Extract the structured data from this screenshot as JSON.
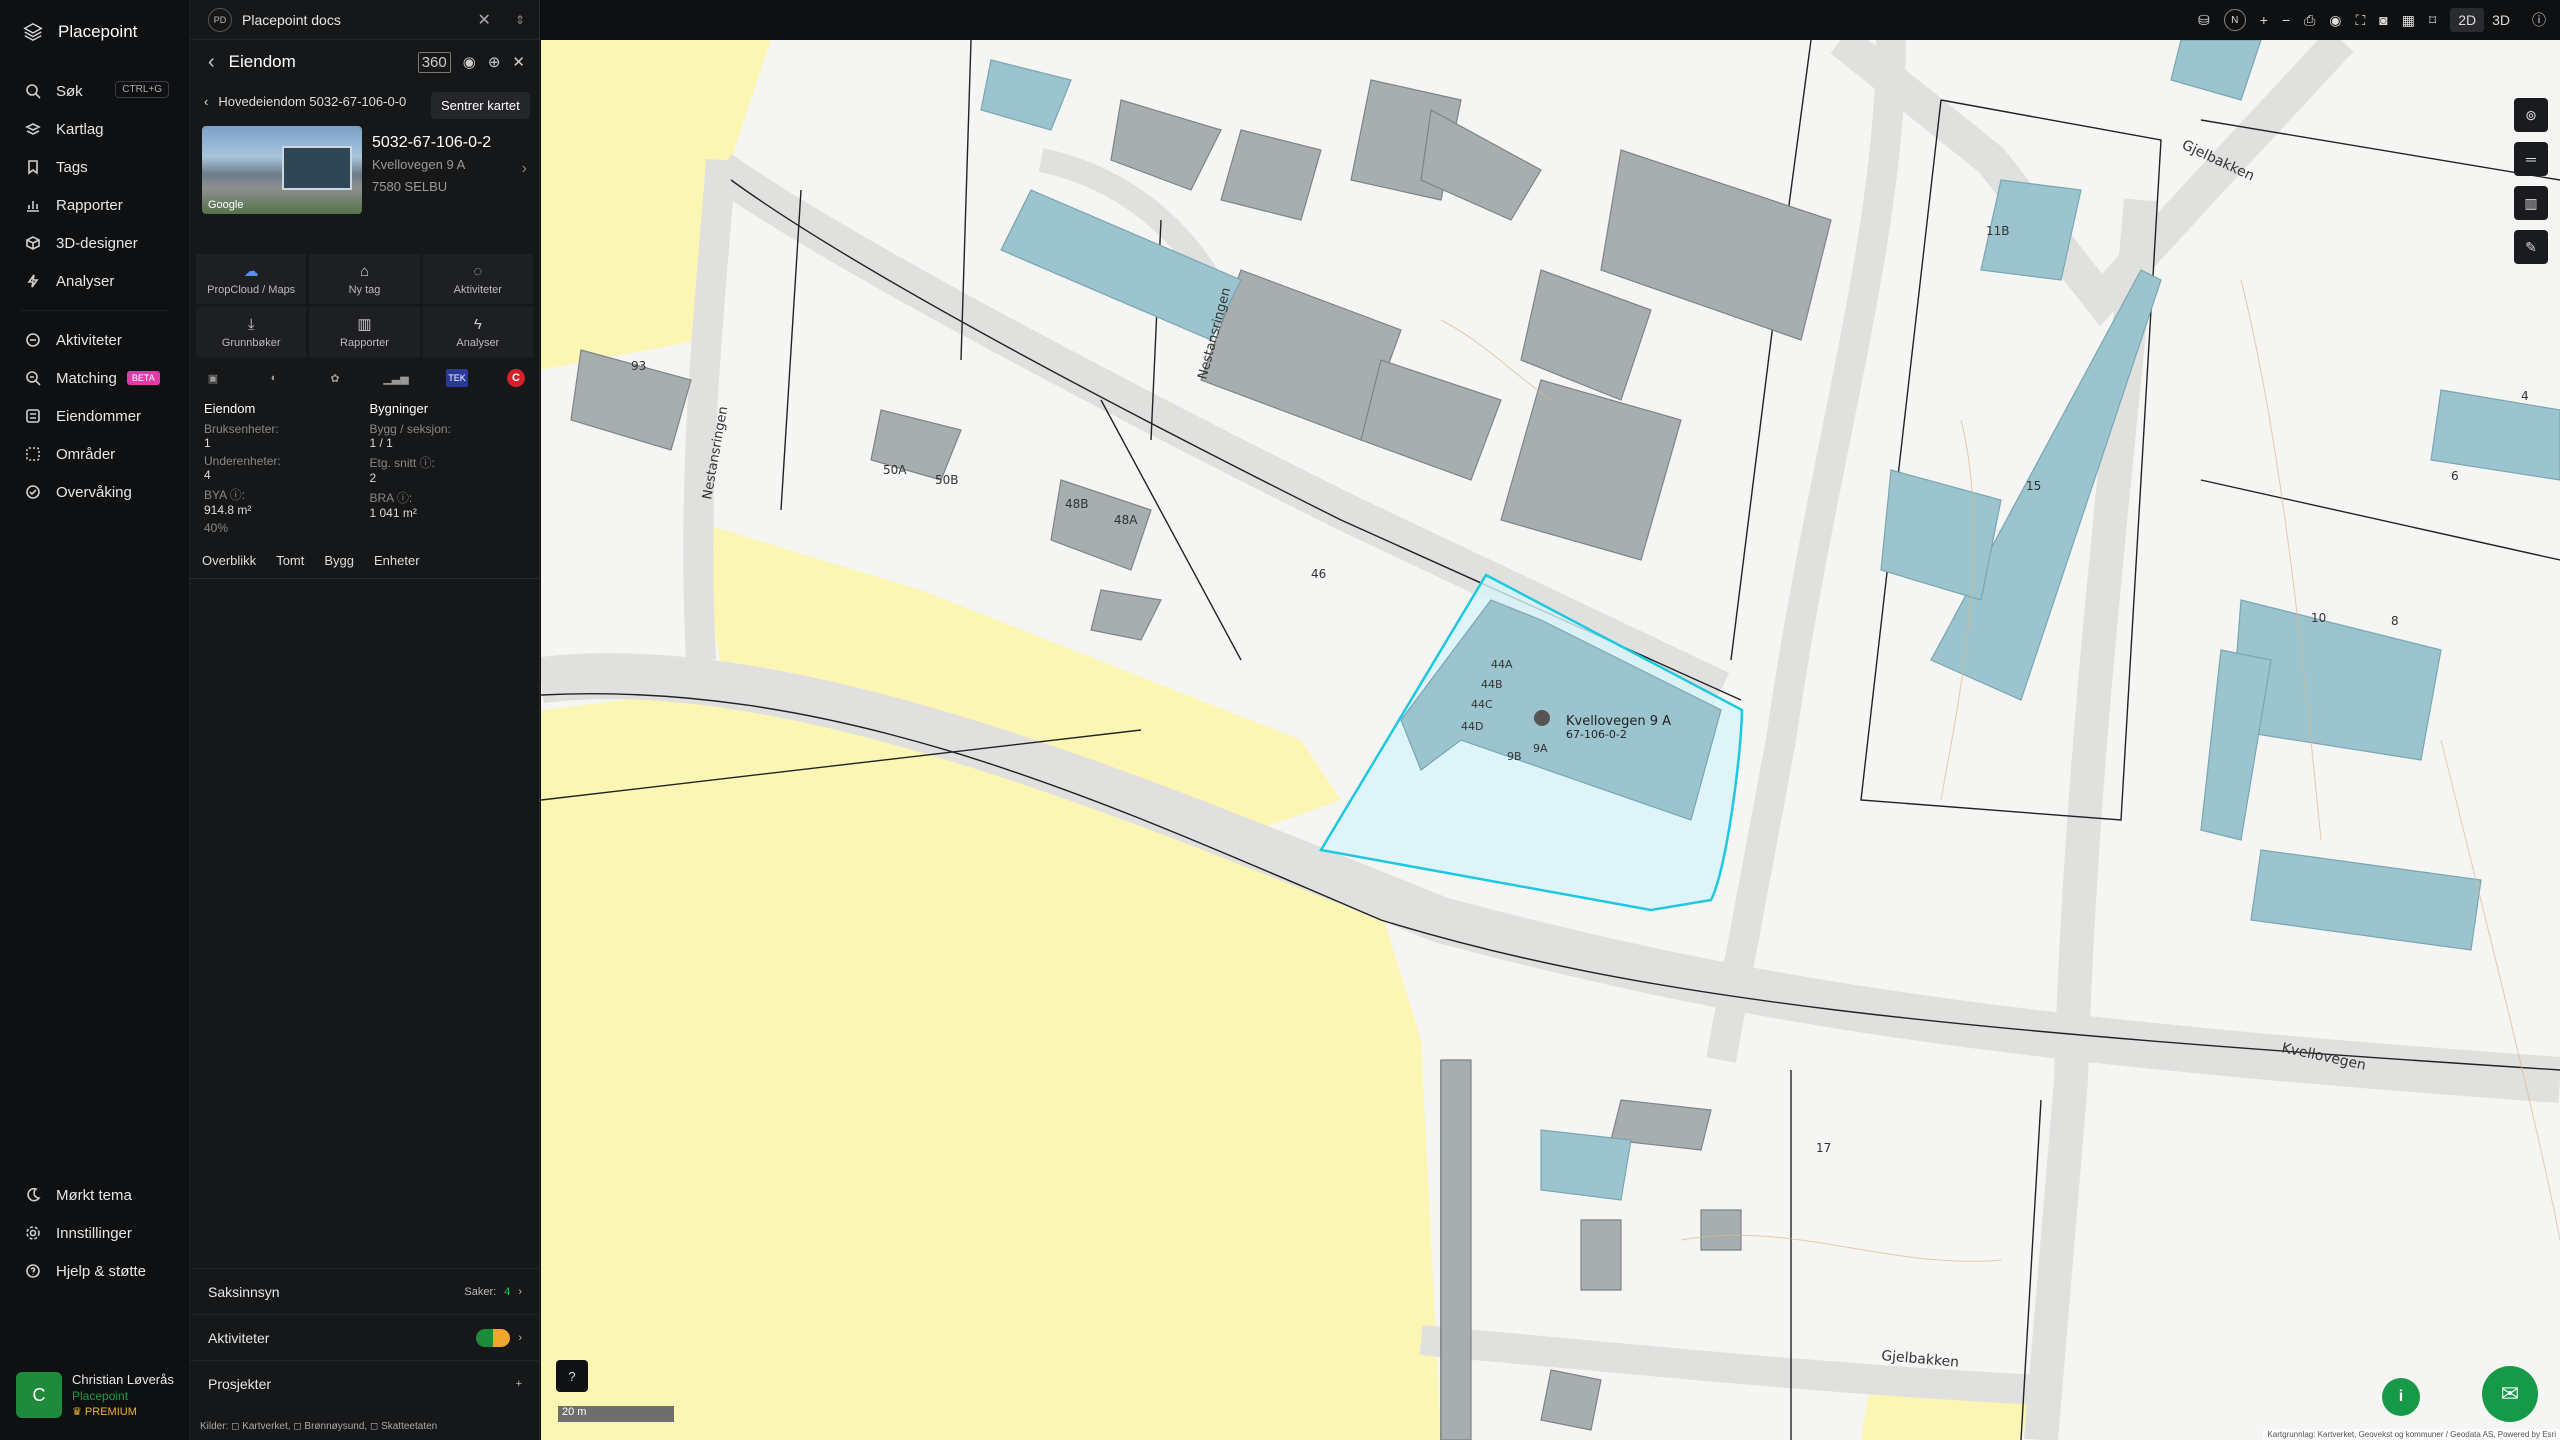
{
  "app": {
    "name": "Placepoint"
  },
  "nav": {
    "items": [
      {
        "label": "Søk",
        "icon": "search-icon",
        "shortcut": "CTRL+G"
      },
      {
        "label": "Kartlag",
        "icon": "layers-icon"
      },
      {
        "label": "Tags",
        "icon": "bookmark-icon"
      },
      {
        "label": "Rapporter",
        "icon": "chart-icon"
      },
      {
        "label": "3D-designer",
        "icon": "cube-icon"
      },
      {
        "label": "Analyser",
        "icon": "bolt-icon"
      }
    ],
    "items2": [
      {
        "label": "Aktiviteter",
        "icon": "activity-icon"
      },
      {
        "label": "Matching",
        "icon": "match-icon",
        "badge": "BETA"
      },
      {
        "label": "Eiendommer",
        "icon": "list-icon"
      },
      {
        "label": "Områder",
        "icon": "area-icon"
      },
      {
        "label": "Overvåking",
        "icon": "watch-icon"
      }
    ],
    "bottom": [
      {
        "label": "Mørkt tema",
        "icon": "moon-icon"
      },
      {
        "label": "Innstillinger",
        "icon": "gear-icon"
      },
      {
        "label": "Hjelp & støtte",
        "icon": "help-icon"
      }
    ]
  },
  "user": {
    "initial": "C",
    "name": "Christian Løverås",
    "org": "Placepoint",
    "plan": "PREMIUM"
  },
  "docs": {
    "badge": "PD",
    "title": "Placepoint docs"
  },
  "panel": {
    "title": "Eiendom",
    "tooltip": "Sentrer kartet",
    "breadcrumb": "Hovedeiendom 5032-67-106-0-0",
    "property": {
      "id": "5032-67-106-0-2",
      "address": "Kvellovegen 9 A",
      "postal": "7580 SELBU",
      "photo_credit": "Google"
    },
    "buttons": [
      {
        "label": "PropCloud / Maps"
      },
      {
        "label": "Ny tag"
      },
      {
        "label": "Aktiviteter"
      },
      {
        "label": "Grunnbøker"
      },
      {
        "label": "Rapporter"
      },
      {
        "label": "Analyser"
      }
    ],
    "tek_label": "TEK",
    "c_label": "C",
    "stats": {
      "left_head": "Eiendom",
      "right_head": "Bygninger",
      "bruks_l": "Bruksenheter:",
      "bruks_v": "1",
      "under_l": "Underenheter:",
      "under_v": "4",
      "bya_l": "BYA ⓘ:",
      "bya_v": "914.8 m²",
      "bya_pct": "40%",
      "bygg_l": "Bygg / seksjon:",
      "bygg_v": "1 / 1",
      "etg_l": "Etg. snitt ⓘ:",
      "etg_v": "2",
      "bra_l": "BRA ⓘ:",
      "bra_v": "1 041 m²"
    },
    "tabs": [
      "Overblikk",
      "Tomt",
      "Bygg",
      "Enheter"
    ],
    "saksinnsyn": {
      "label": "Saksinnsyn",
      "count_label": "Saker:",
      "count": "4"
    },
    "aktiviteter": {
      "label": "Aktiviteter"
    },
    "prosjekter": {
      "label": "Prosjekter"
    },
    "sources": "Kilder: ◻ Kartverket, ◻ Brønnøysund, ◻ Skatteetaten"
  },
  "topbar": {
    "mode_2d": "2D",
    "mode_3d": "3D",
    "compass": "N"
  },
  "map": {
    "scale": "20 m",
    "attribution": "Kartgrunnlag: Kartverket, Geovekst og kommuner / Geodata AS, Powered by Esri",
    "labels": {
      "selected_addr": "Kvellovegen 9 A",
      "selected_id": "67-106-0-2",
      "road1": "Kvellovegen",
      "road2": "Gjelbakken",
      "road3": "Gjelbakken",
      "road4": "Nestansringen",
      "road5": "Nestansringen",
      "num46": "46",
      "num15": "15",
      "num11b": "11B",
      "num44a": "44A",
      "num44b": "44B",
      "num44c": "44C",
      "num44d": "44D",
      "num9a": "9A",
      "num9b": "9B",
      "num17": "17",
      "num10": "10",
      "num8": "8",
      "num6": "6",
      "num4": "4",
      "num93": "93",
      "num50a": "50A",
      "num50b": "50B",
      "num48a": "48A",
      "num48b": "48B"
    }
  }
}
